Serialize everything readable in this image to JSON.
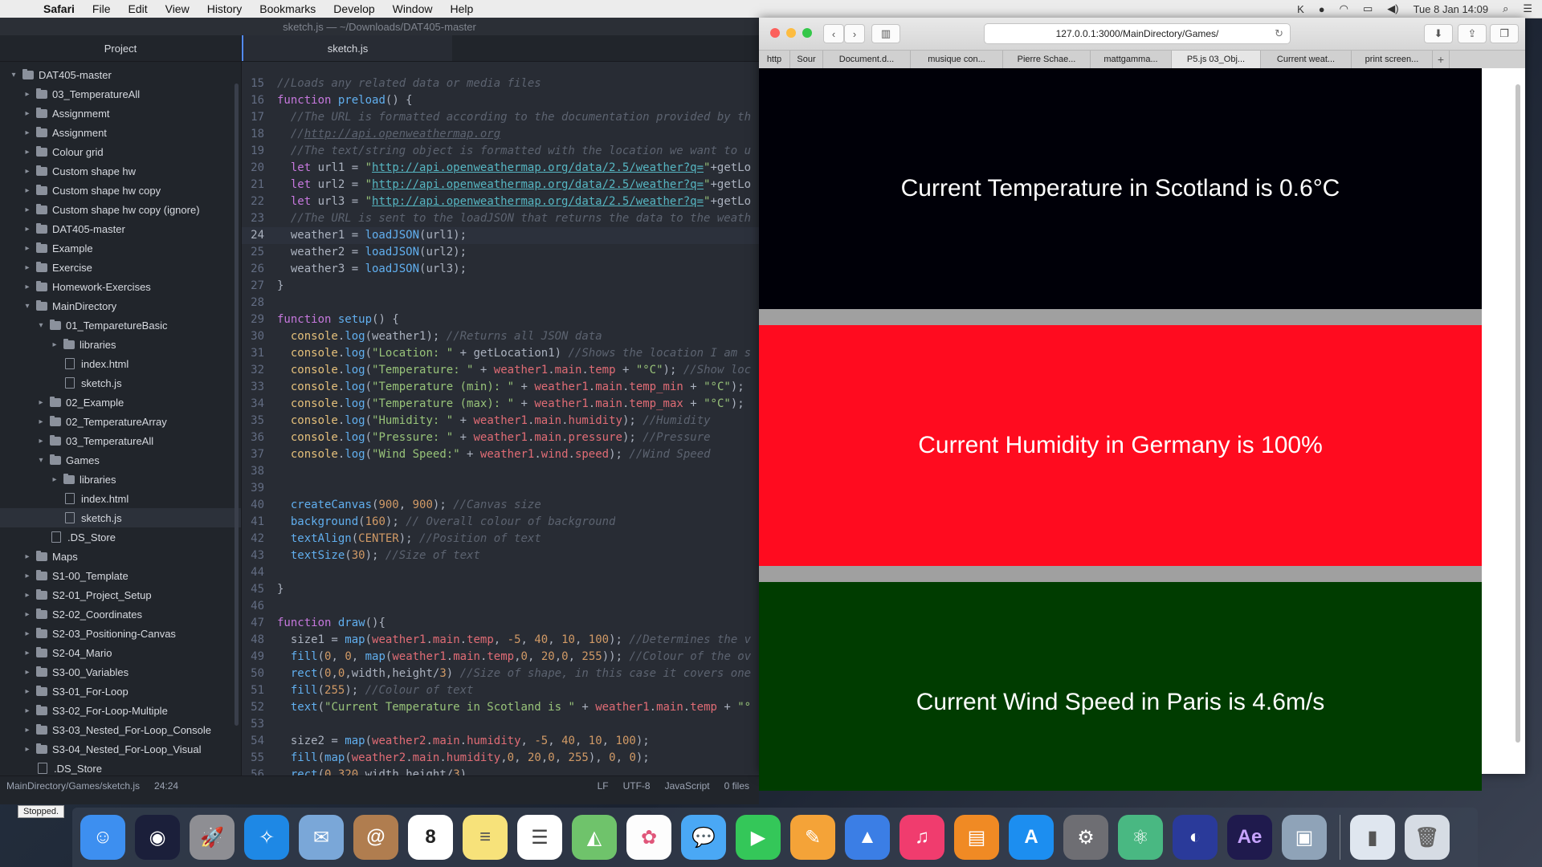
{
  "menubar": {
    "app": "Safari",
    "items": [
      "File",
      "Edit",
      "View",
      "History",
      "Bookmarks",
      "Develop",
      "Window",
      "Help"
    ],
    "clock": "Tue 8 Jan  14:09"
  },
  "atom": {
    "title": "sketch.js — ~/Downloads/DAT405-master",
    "project_label": "Project",
    "tab_label": "sketch.js",
    "tree": [
      {
        "label": "DAT405-master",
        "depth": 0,
        "type": "folder",
        "open": true
      },
      {
        "label": "03_TemperatureAll",
        "depth": 1,
        "type": "folder",
        "open": false
      },
      {
        "label": "Assignmemt",
        "depth": 1,
        "type": "folder",
        "open": false
      },
      {
        "label": "Assignment",
        "depth": 1,
        "type": "folder",
        "open": false
      },
      {
        "label": "Colour grid",
        "depth": 1,
        "type": "folder",
        "open": false
      },
      {
        "label": "Custom shape hw",
        "depth": 1,
        "type": "folder",
        "open": false
      },
      {
        "label": "Custom shape hw copy",
        "depth": 1,
        "type": "folder",
        "open": false
      },
      {
        "label": "Custom shape hw copy (ignore)",
        "depth": 1,
        "type": "folder",
        "open": false
      },
      {
        "label": "DAT405-master",
        "depth": 1,
        "type": "folder",
        "open": false
      },
      {
        "label": "Example",
        "depth": 1,
        "type": "folder",
        "open": false
      },
      {
        "label": "Exercise",
        "depth": 1,
        "type": "folder",
        "open": false
      },
      {
        "label": "Homework-Exercises",
        "depth": 1,
        "type": "folder",
        "open": false
      },
      {
        "label": "MainDirectory",
        "depth": 1,
        "type": "folder",
        "open": true
      },
      {
        "label": "01_TemparetureBasic",
        "depth": 2,
        "type": "folder",
        "open": true
      },
      {
        "label": "libraries",
        "depth": 3,
        "type": "folder",
        "open": false
      },
      {
        "label": "index.html",
        "depth": 3,
        "type": "file"
      },
      {
        "label": "sketch.js",
        "depth": 3,
        "type": "file"
      },
      {
        "label": "02_Example",
        "depth": 2,
        "type": "folder",
        "open": false
      },
      {
        "label": "02_TemperatureArray",
        "depth": 2,
        "type": "folder",
        "open": false
      },
      {
        "label": "03_TemperatureAll",
        "depth": 2,
        "type": "folder",
        "open": false
      },
      {
        "label": "Games",
        "depth": 2,
        "type": "folder",
        "open": true
      },
      {
        "label": "libraries",
        "depth": 3,
        "type": "folder",
        "open": false
      },
      {
        "label": "index.html",
        "depth": 3,
        "type": "file"
      },
      {
        "label": "sketch.js",
        "depth": 3,
        "type": "file",
        "selected": true
      },
      {
        "label": ".DS_Store",
        "depth": 2,
        "type": "file"
      },
      {
        "label": "Maps",
        "depth": 1,
        "type": "folder",
        "open": false
      },
      {
        "label": "S1-00_Template",
        "depth": 1,
        "type": "folder",
        "open": false
      },
      {
        "label": "S2-01_Project_Setup",
        "depth": 1,
        "type": "folder",
        "open": false
      },
      {
        "label": "S2-02_Coordinates",
        "depth": 1,
        "type": "folder",
        "open": false
      },
      {
        "label": "S2-03_Positioning-Canvas",
        "depth": 1,
        "type": "folder",
        "open": false
      },
      {
        "label": "S2-04_Mario",
        "depth": 1,
        "type": "folder",
        "open": false
      },
      {
        "label": "S3-00_Variables",
        "depth": 1,
        "type": "folder",
        "open": false
      },
      {
        "label": "S3-01_For-Loop",
        "depth": 1,
        "type": "folder",
        "open": false
      },
      {
        "label": "S3-02_For-Loop-Multiple",
        "depth": 1,
        "type": "folder",
        "open": false
      },
      {
        "label": "S3-03_Nested_For-Loop_Console",
        "depth": 1,
        "type": "folder",
        "open": false
      },
      {
        "label": "S3-04_Nested_For-Loop_Visual",
        "depth": 1,
        "type": "folder",
        "open": false
      },
      {
        "label": ".DS_Store",
        "depth": 1,
        "type": "file"
      }
    ],
    "code": [
      {
        "n": 15,
        "html": "<span class=\"cm\">//Loads any related data or media files</span>"
      },
      {
        "n": 16,
        "html": "<span class=\"kw\">function</span> <span class=\"fn\">preload</span>() {"
      },
      {
        "n": 17,
        "html": "  <span class=\"cm\">//The URL is formatted according to the documentation provided by th</span>"
      },
      {
        "n": 18,
        "html": "  <span class=\"cm\">//</span><span class=\"cmurl\">http://api.openweathermap.org</span>"
      },
      {
        "n": 19,
        "html": "  <span class=\"cm\">//The text/string object is formatted with the location we want to u</span>"
      },
      {
        "n": 20,
        "html": "  <span class=\"kw\">let</span> url1 = <span class=\"str\">\"</span><span class=\"url\">http://api.openweathermap.org/data/2.5/weather?q=</span><span class=\"str\">\"</span>+getLo"
      },
      {
        "n": 21,
        "html": "  <span class=\"kw\">let</span> url2 = <span class=\"str\">\"</span><span class=\"url\">http://api.openweathermap.org/data/2.5/weather?q=</span><span class=\"str\">\"</span>+getLo"
      },
      {
        "n": 22,
        "html": "  <span class=\"kw\">let</span> url3 = <span class=\"str\">\"</span><span class=\"url\">http://api.openweathermap.org/data/2.5/weather?q=</span><span class=\"str\">\"</span>+getLo"
      },
      {
        "n": 23,
        "html": "  <span class=\"cm\">//The URL is sent to the loadJSON that returns the data to the weath</span>"
      },
      {
        "n": 24,
        "html": "  weather1 = <span class=\"fn\">loadJSON</span>(url1);",
        "active": true
      },
      {
        "n": 25,
        "html": "  weather2 = <span class=\"fn\">loadJSON</span>(url2);"
      },
      {
        "n": 26,
        "html": "  weather3 = <span class=\"fn\">loadJSON</span>(url3);"
      },
      {
        "n": 27,
        "html": "}"
      },
      {
        "n": 28,
        "html": ""
      },
      {
        "n": 29,
        "html": "<span class=\"kw\">function</span> <span class=\"fn\">setup</span>() {"
      },
      {
        "n": 30,
        "html": "  <span class=\"obj\">console</span>.<span class=\"fn\">log</span>(weather1); <span class=\"cm\">//Returns all JSON data</span>"
      },
      {
        "n": 31,
        "html": "  <span class=\"obj\">console</span>.<span class=\"fn\">log</span>(<span class=\"str\">\"Location: \"</span> + getLocation1) <span class=\"cm\">//Shows the location I am s</span>"
      },
      {
        "n": 32,
        "html": "  <span class=\"obj\">console</span>.<span class=\"fn\">log</span>(<span class=\"str\">\"Temperature: \"</span> + <span class=\"prop\">weather1</span>.<span class=\"prop\">main</span>.<span class=\"prop\">temp</span> + <span class=\"str\">\"°C\"</span>); <span class=\"cm\">//Show loc</span>"
      },
      {
        "n": 33,
        "html": "  <span class=\"obj\">console</span>.<span class=\"fn\">log</span>(<span class=\"str\">\"Temperature (min): \"</span> + <span class=\"prop\">weather1</span>.<span class=\"prop\">main</span>.<span class=\"prop\">temp_min</span> + <span class=\"str\">\"°C\"</span>);"
      },
      {
        "n": 34,
        "html": "  <span class=\"obj\">console</span>.<span class=\"fn\">log</span>(<span class=\"str\">\"Temperature (max): \"</span> + <span class=\"prop\">weather1</span>.<span class=\"prop\">main</span>.<span class=\"prop\">temp_max</span> + <span class=\"str\">\"°C\"</span>);"
      },
      {
        "n": 35,
        "html": "  <span class=\"obj\">console</span>.<span class=\"fn\">log</span>(<span class=\"str\">\"Humidity: \"</span> + <span class=\"prop\">weather1</span>.<span class=\"prop\">main</span>.<span class=\"prop\">humidity</span>); <span class=\"cm\">//Humidity</span>"
      },
      {
        "n": 36,
        "html": "  <span class=\"obj\">console</span>.<span class=\"fn\">log</span>(<span class=\"str\">\"Pressure: \"</span> + <span class=\"prop\">weather1</span>.<span class=\"prop\">main</span>.<span class=\"prop\">pressure</span>); <span class=\"cm\">//Pressure</span>"
      },
      {
        "n": 37,
        "html": "  <span class=\"obj\">console</span>.<span class=\"fn\">log</span>(<span class=\"str\">\"Wind Speed:\"</span> + <span class=\"prop\">weather1</span>.<span class=\"prop\">wind</span>.<span class=\"prop\">speed</span>); <span class=\"cm\">//Wind Speed</span>"
      },
      {
        "n": 38,
        "html": ""
      },
      {
        "n": 39,
        "html": ""
      },
      {
        "n": 40,
        "html": "  <span class=\"fn\">createCanvas</span>(<span class=\"num\">900</span>, <span class=\"num\">900</span>); <span class=\"cm\">//Canvas size</span>"
      },
      {
        "n": 41,
        "html": "  <span class=\"fn\">background</span>(<span class=\"num\">160</span>); <span class=\"cm\">// Overall colour of background</span>"
      },
      {
        "n": 42,
        "html": "  <span class=\"fn\">textAlign</span>(<span class=\"num\">CENTER</span>); <span class=\"cm\">//Position of text</span>"
      },
      {
        "n": 43,
        "html": "  <span class=\"fn\">textSize</span>(<span class=\"num\">30</span>); <span class=\"cm\">//Size of text</span>"
      },
      {
        "n": 44,
        "html": ""
      },
      {
        "n": 45,
        "html": "}"
      },
      {
        "n": 46,
        "html": ""
      },
      {
        "n": 47,
        "html": "<span class=\"kw\">function</span> <span class=\"fn\">draw</span>(){"
      },
      {
        "n": 48,
        "html": "  size1 = <span class=\"fn\">map</span>(<span class=\"prop\">weather1</span>.<span class=\"prop\">main</span>.<span class=\"prop\">temp</span>, <span class=\"num\">-5</span>, <span class=\"num\">40</span>, <span class=\"num\">10</span>, <span class=\"num\">100</span>); <span class=\"cm\">//Determines the v</span>"
      },
      {
        "n": 49,
        "html": "  <span class=\"fn\">fill</span>(<span class=\"num\">0</span>, <span class=\"num\">0</span>, <span class=\"fn\">map</span>(<span class=\"prop\">weather1</span>.<span class=\"prop\">main</span>.<span class=\"prop\">temp</span>,<span class=\"num\">0</span>, <span class=\"num\">20</span>,<span class=\"num\">0</span>, <span class=\"num\">255</span>)); <span class=\"cm\">//Colour of the ov</span>"
      },
      {
        "n": 50,
        "html": "  <span class=\"fn\">rect</span>(<span class=\"num\">0</span>,<span class=\"num\">0</span>,width,height/<span class=\"num\">3</span>) <span class=\"cm\">//Size of shape, in this case it covers one</span>"
      },
      {
        "n": 51,
        "html": "  <span class=\"fn\">fill</span>(<span class=\"num\">255</span>); <span class=\"cm\">//Colour of text</span>"
      },
      {
        "n": 52,
        "html": "  <span class=\"fn\">text</span>(<span class=\"str\">\"Current Temperature in Scotland is \"</span> + <span class=\"prop\">weather1</span>.<span class=\"prop\">main</span>.<span class=\"prop\">temp</span> + <span class=\"str\">\"°</span>"
      },
      {
        "n": 53,
        "html": ""
      },
      {
        "n": 54,
        "html": "  size2 = <span class=\"fn\">map</span>(<span class=\"prop\">weather2</span>.<span class=\"prop\">main</span>.<span class=\"prop\">humidity</span>, <span class=\"num\">-5</span>, <span class=\"num\">40</span>, <span class=\"num\">10</span>, <span class=\"num\">100</span>);"
      },
      {
        "n": 55,
        "html": "  <span class=\"fn\">fill</span>(<span class=\"fn\">map</span>(<span class=\"prop\">weather2</span>.<span class=\"prop\">main</span>.<span class=\"prop\">humidity</span>,<span class=\"num\">0</span>, <span class=\"num\">20</span>,<span class=\"num\">0</span>, <span class=\"num\">255</span>), <span class=\"num\">0</span>, <span class=\"num\">0</span>);"
      },
      {
        "n": 56,
        "html": "  <span class=\"fn\">rect</span>(<span class=\"num\">0</span>,<span class=\"num\">320</span>,width,height/<span class=\"num\">3</span>)"
      }
    ],
    "status": {
      "path": "MainDirectory/Games/sketch.js",
      "cursor": "24:24",
      "line_ending": "LF",
      "encoding": "UTF-8",
      "grammar": "JavaScript",
      "files": "0 files"
    }
  },
  "safari": {
    "url": "127.0.0.1:3000/MainDirectory/Games/",
    "tabs": [
      {
        "label": "http"
      },
      {
        "label": "Sour"
      },
      {
        "label": "Document.d..."
      },
      {
        "label": "musique con..."
      },
      {
        "label": "Pierre Schae..."
      },
      {
        "label": "mattgamma..."
      },
      {
        "label": "P5.js 03_Obj...",
        "active": true
      },
      {
        "label": "Current weat..."
      },
      {
        "label": "print screen..."
      }
    ],
    "bands": [
      {
        "text": "Current Temperature in Scotland is 0.6°C",
        "color": "#000008"
      },
      {
        "text": "Current Humidity in Germany is 100%",
        "color": "#ff0b1f"
      },
      {
        "text": "Current Wind Speed in Paris is 4.6m/s",
        "color": "#003c00"
      }
    ]
  },
  "dock": {
    "tooltip": "Stopped.",
    "apps": [
      {
        "name": "finder-icon",
        "color": "#3d8ff0",
        "glyph": "☺"
      },
      {
        "name": "siri-icon",
        "color": "#1b1f3a",
        "glyph": "◉"
      },
      {
        "name": "launchpad-icon",
        "color": "#8e8e93",
        "glyph": "🚀"
      },
      {
        "name": "safari-icon",
        "color": "#1e88e5",
        "glyph": "✧"
      },
      {
        "name": "mail-icon",
        "color": "#7aa7d8",
        "glyph": "✉"
      },
      {
        "name": "contacts-icon",
        "color": "#b07d4f",
        "glyph": "@"
      },
      {
        "name": "calendar-icon",
        "color": "#ffffff",
        "glyph": "8",
        "text_color": "#222"
      },
      {
        "name": "notes-icon",
        "color": "#f7e27a",
        "glyph": "≡",
        "text_color": "#555"
      },
      {
        "name": "reminders-icon",
        "color": "#ffffff",
        "glyph": "☰",
        "text_color": "#444"
      },
      {
        "name": "maps-icon",
        "color": "#6fc36b",
        "glyph": "◭"
      },
      {
        "name": "photos-icon",
        "color": "#fdfdfd",
        "glyph": "✿",
        "text_color": "#e0567a"
      },
      {
        "name": "messages-icon",
        "color": "#4aa8f5",
        "glyph": "💬"
      },
      {
        "name": "facetime-icon",
        "color": "#34c759",
        "glyph": "▶"
      },
      {
        "name": "pages-icon",
        "color": "#f4a338",
        "glyph": "✎"
      },
      {
        "name": "keynote-icon",
        "color": "#3b7ee5",
        "glyph": "▲"
      },
      {
        "name": "itunes-icon",
        "color": "#f03c6e",
        "glyph": "♫"
      },
      {
        "name": "ibooks-icon",
        "color": "#f08a24",
        "glyph": "▤"
      },
      {
        "name": "app-store-icon",
        "color": "#1c8ef0",
        "glyph": "A"
      },
      {
        "name": "system-preferences-icon",
        "color": "#6e6e73",
        "glyph": "⚙"
      },
      {
        "name": "atom-icon",
        "color": "#49b882",
        "glyph": "⚛"
      },
      {
        "name": "audacity-icon",
        "color": "#2a3a9a",
        "glyph": "◐"
      },
      {
        "name": "after-effects-icon",
        "color": "#1f1a4d",
        "glyph": "Ae",
        "text_color": "#c7a4ff"
      },
      {
        "name": "preview-icon",
        "color": "#8fa3b8",
        "glyph": "▣"
      }
    ],
    "right": [
      {
        "name": "archive-icon",
        "color": "#dfe6ef",
        "glyph": "▮",
        "text_color": "#555"
      },
      {
        "name": "trash-icon",
        "color": "#d6dce4",
        "glyph": "🗑",
        "text_color": "#666"
      }
    ]
  }
}
